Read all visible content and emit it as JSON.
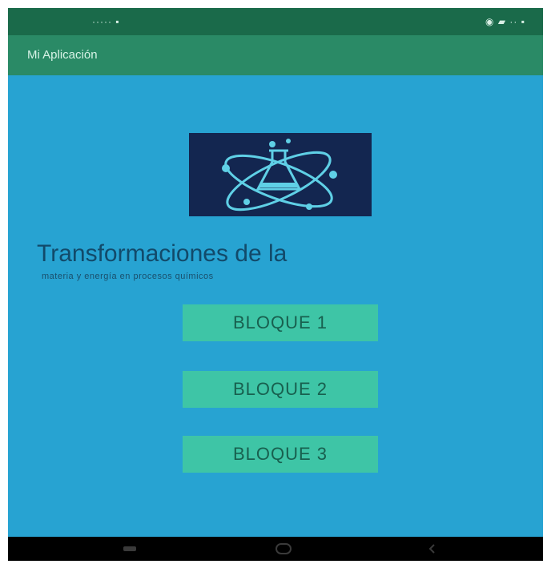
{
  "status_bar": {
    "left_text": "·····  ▪",
    "right_text": "◉ ▰ ·· ▪"
  },
  "app_bar": {
    "title": "Mi Aplicación"
  },
  "main": {
    "heading": "Transformaciones de la",
    "subheading": "materia y energía en procesos químicos"
  },
  "buttons": [
    {
      "label": "BLOQUE 1"
    },
    {
      "label": "BLOQUE 2"
    },
    {
      "label": "BLOQUE 3"
    }
  ],
  "icons": {
    "logo": "atom-flask-icon",
    "nav_back": "back-icon",
    "nav_home": "home-icon",
    "nav_recent": "recent-apps-icon"
  },
  "colors": {
    "background": "#27a3d2",
    "status_bar": "#1a6a4a",
    "app_bar": "#2a8a66",
    "button": "#3ec5a6",
    "logo_background": "#132650"
  }
}
